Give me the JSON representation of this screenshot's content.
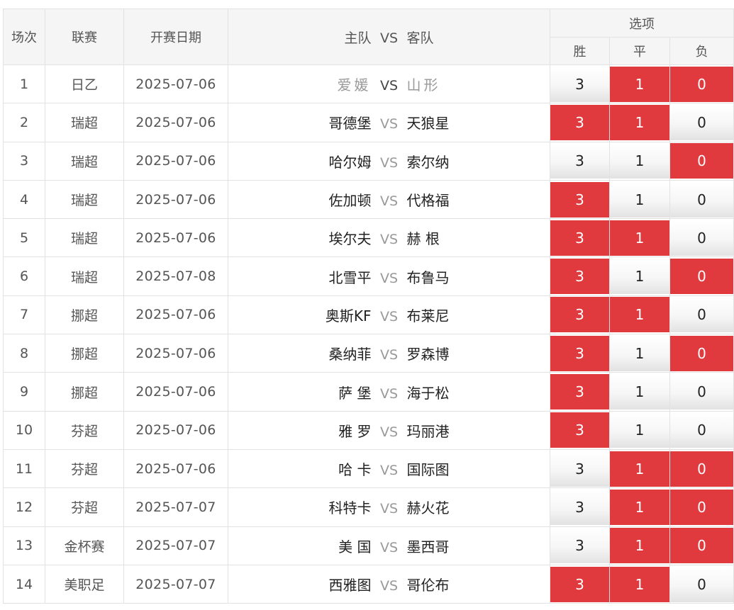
{
  "header": {
    "col_no": "场次",
    "col_league": "联赛",
    "col_date": "开赛日期",
    "col_home": "主队",
    "col_vs": "VS",
    "col_away": "客队",
    "col_options": "选项",
    "opt_win": "胜",
    "opt_draw": "平",
    "opt_lose": "负"
  },
  "colors": {
    "selected": "#e03a3e",
    "unselected": "#f2f2f2"
  },
  "rows": [
    {
      "no": "1",
      "league": "日乙",
      "date": "2025-07-06",
      "home": "爱媛",
      "vs": "VS",
      "away": "山形",
      "w": "3",
      "d": "1",
      "l": "0",
      "sel": [
        false,
        true,
        true
      ]
    },
    {
      "no": "2",
      "league": "瑞超",
      "date": "2025-07-06",
      "home": "哥德堡",
      "vs": "VS",
      "away": "天狼星",
      "w": "3",
      "d": "1",
      "l": "0",
      "sel": [
        true,
        true,
        false
      ]
    },
    {
      "no": "3",
      "league": "瑞超",
      "date": "2025-07-06",
      "home": "哈尔姆",
      "vs": "VS",
      "away": "索尔纳",
      "w": "3",
      "d": "1",
      "l": "0",
      "sel": [
        false,
        false,
        true
      ]
    },
    {
      "no": "4",
      "league": "瑞超",
      "date": "2025-07-06",
      "home": "佐加顿",
      "vs": "VS",
      "away": "代格福",
      "w": "3",
      "d": "1",
      "l": "0",
      "sel": [
        true,
        false,
        false
      ]
    },
    {
      "no": "5",
      "league": "瑞超",
      "date": "2025-07-06",
      "home": "埃尔夫",
      "vs": "VS",
      "away": "赫 根",
      "w": "3",
      "d": "1",
      "l": "0",
      "sel": [
        true,
        true,
        false
      ]
    },
    {
      "no": "6",
      "league": "瑞超",
      "date": "2025-07-08",
      "home": "北雪平",
      "vs": "VS",
      "away": "布鲁马",
      "w": "3",
      "d": "1",
      "l": "0",
      "sel": [
        true,
        false,
        true
      ]
    },
    {
      "no": "7",
      "league": "挪超",
      "date": "2025-07-06",
      "home": "奥斯KF",
      "vs": "VS",
      "away": "布莱尼",
      "w": "3",
      "d": "1",
      "l": "0",
      "sel": [
        true,
        true,
        false
      ]
    },
    {
      "no": "8",
      "league": "挪超",
      "date": "2025-07-06",
      "home": "桑纳菲",
      "vs": "VS",
      "away": "罗森博",
      "w": "3",
      "d": "1",
      "l": "0",
      "sel": [
        true,
        false,
        true
      ]
    },
    {
      "no": "9",
      "league": "挪超",
      "date": "2025-07-06",
      "home": "萨 堡",
      "vs": "VS",
      "away": "海于松",
      "w": "3",
      "d": "1",
      "l": "0",
      "sel": [
        true,
        false,
        false
      ]
    },
    {
      "no": "10",
      "league": "芬超",
      "date": "2025-07-06",
      "home": "雅 罗",
      "vs": "VS",
      "away": "玛丽港",
      "w": "3",
      "d": "1",
      "l": "0",
      "sel": [
        true,
        false,
        false
      ]
    },
    {
      "no": "11",
      "league": "芬超",
      "date": "2025-07-06",
      "home": "哈 卡",
      "vs": "VS",
      "away": "国际图",
      "w": "3",
      "d": "1",
      "l": "0",
      "sel": [
        false,
        true,
        true
      ]
    },
    {
      "no": "12",
      "league": "芬超",
      "date": "2025-07-07",
      "home": "科特卡",
      "vs": "VS",
      "away": "赫火花",
      "w": "3",
      "d": "1",
      "l": "0",
      "sel": [
        false,
        true,
        true
      ]
    },
    {
      "no": "13",
      "league": "金杯赛",
      "date": "2025-07-07",
      "home": "美 国",
      "vs": "VS",
      "away": "墨西哥",
      "w": "3",
      "d": "1",
      "l": "0",
      "sel": [
        false,
        true,
        true
      ]
    },
    {
      "no": "14",
      "league": "美职足",
      "date": "2025-07-07",
      "home": "西雅图",
      "vs": "VS",
      "away": "哥伦布",
      "w": "3",
      "d": "1",
      "l": "0",
      "sel": [
        true,
        true,
        false
      ]
    }
  ]
}
